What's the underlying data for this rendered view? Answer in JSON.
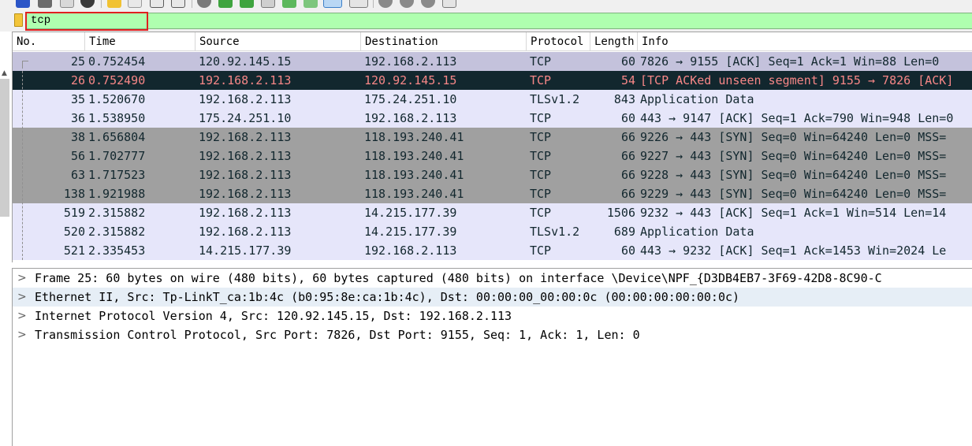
{
  "filter": {
    "value": "tcp"
  },
  "packet_list": {
    "columns": [
      "No.",
      "Time",
      "Source",
      "Destination",
      "Protocol",
      "Length",
      "Info"
    ],
    "rows": [
      {
        "no": "25",
        "time": "0.752454",
        "source": "120.92.145.15",
        "destination": "192.168.2.113",
        "protocol": "TCP",
        "length": "60",
        "info": "7826 → 9155 [ACK] Seq=1 Ack=1 Win=88 Len=0",
        "style": "sel-top"
      },
      {
        "no": "26",
        "time": "0.752490",
        "source": "192.168.2.113",
        "destination": "120.92.145.15",
        "protocol": "TCP",
        "length": "54",
        "info": "[TCP ACKed unseen segment] 9155 → 7826 [ACK]",
        "style": "sel"
      },
      {
        "no": "35",
        "time": "1.520670",
        "source": "192.168.2.113",
        "destination": "175.24.251.10",
        "protocol": "TLSv1.2",
        "length": "843",
        "info": "Application Data",
        "style": "lav"
      },
      {
        "no": "36",
        "time": "1.538950",
        "source": "175.24.251.10",
        "destination": "192.168.2.113",
        "protocol": "TCP",
        "length": "60",
        "info": "443 → 9147 [ACK] Seq=1 Ack=790 Win=948 Len=0",
        "style": "lav"
      },
      {
        "no": "38",
        "time": "1.656804",
        "source": "192.168.2.113",
        "destination": "118.193.240.41",
        "protocol": "TCP",
        "length": "66",
        "info": "9226 → 443 [SYN] Seq=0 Win=64240 Len=0 MSS=",
        "style": "gray"
      },
      {
        "no": "56",
        "time": "1.702777",
        "source": "192.168.2.113",
        "destination": "118.193.240.41",
        "protocol": "TCP",
        "length": "66",
        "info": "9227 → 443 [SYN] Seq=0 Win=64240 Len=0 MSS=",
        "style": "gray"
      },
      {
        "no": "63",
        "time": "1.717523",
        "source": "192.168.2.113",
        "destination": "118.193.240.41",
        "protocol": "TCP",
        "length": "66",
        "info": "9228 → 443 [SYN] Seq=0 Win=64240 Len=0 MSS=",
        "style": "gray"
      },
      {
        "no": "138",
        "time": "1.921988",
        "source": "192.168.2.113",
        "destination": "118.193.240.41",
        "protocol": "TCP",
        "length": "66",
        "info": "9229 → 443 [SYN] Seq=0 Win=64240 Len=0 MSS=",
        "style": "gray"
      },
      {
        "no": "519",
        "time": "2.315882",
        "source": "192.168.2.113",
        "destination": "14.215.177.39",
        "protocol": "TCP",
        "length": "1506",
        "info": "9232 → 443 [ACK] Seq=1 Ack=1 Win=514 Len=14",
        "style": "lav"
      },
      {
        "no": "520",
        "time": "2.315882",
        "source": "192.168.2.113",
        "destination": "14.215.177.39",
        "protocol": "TLSv1.2",
        "length": "689",
        "info": "Application Data",
        "style": "lav"
      },
      {
        "no": "521",
        "time": "2.335453",
        "source": "14.215.177.39",
        "destination": "192.168.2.113",
        "protocol": "TCP",
        "length": "60",
        "info": "443 → 9232 [ACK] Seq=1 Ack=1453 Win=2024 Le",
        "style": "lav"
      }
    ]
  },
  "details": {
    "chevron": ">",
    "rows": [
      {
        "text": "Frame 25: 60 bytes on wire (480 bits), 60 bytes captured (480 bits) on interface \\Device\\NPF_{D3DB4EB7-3F69-42D8-8C90-C",
        "highlighted": false
      },
      {
        "text": "Ethernet II, Src: Tp-LinkT_ca:1b:4c (b0:95:8e:ca:1b:4c), Dst: 00:00:00_00:00:0c (00:00:00:00:00:0c)",
        "highlighted": true
      },
      {
        "text": "Internet Protocol Version 4, Src: 120.92.145.15, Dst: 192.168.2.113",
        "highlighted": false
      },
      {
        "text": "Transmission Control Protocol, Src Port: 7826, Dst Port: 9155, Seq: 1, Ack: 1, Len: 0",
        "highlighted": false
      }
    ]
  },
  "icons": {
    "toolbar": [
      "shark-fin-start-icon",
      "stop-icon",
      "restart-icon",
      "options-gear-icon",
      "open-folder-icon",
      "save-file-icon",
      "close-file-icon",
      "reload-icon",
      "find-icon",
      "go-back-icon",
      "go-forward-icon",
      "go-to-packet-icon",
      "go-first-icon",
      "go-last-icon",
      "autoscroll-icon",
      "colorize-icon",
      "zoom-in-icon",
      "zoom-out-icon",
      "zoom-normal-icon",
      "resize-columns-icon"
    ],
    "filter_bookmark": "bookmark-icon",
    "scroll_up": "scroll-up-arrow-icon"
  },
  "colors": {
    "filter_ok": "#afffaf",
    "row_lavender": "#e6e6fa",
    "row_selected_bg": "#12272e",
    "row_selected_fg": "#f78787",
    "row_gray": "#a0a0a0",
    "annotation_box": "#e02020"
  }
}
